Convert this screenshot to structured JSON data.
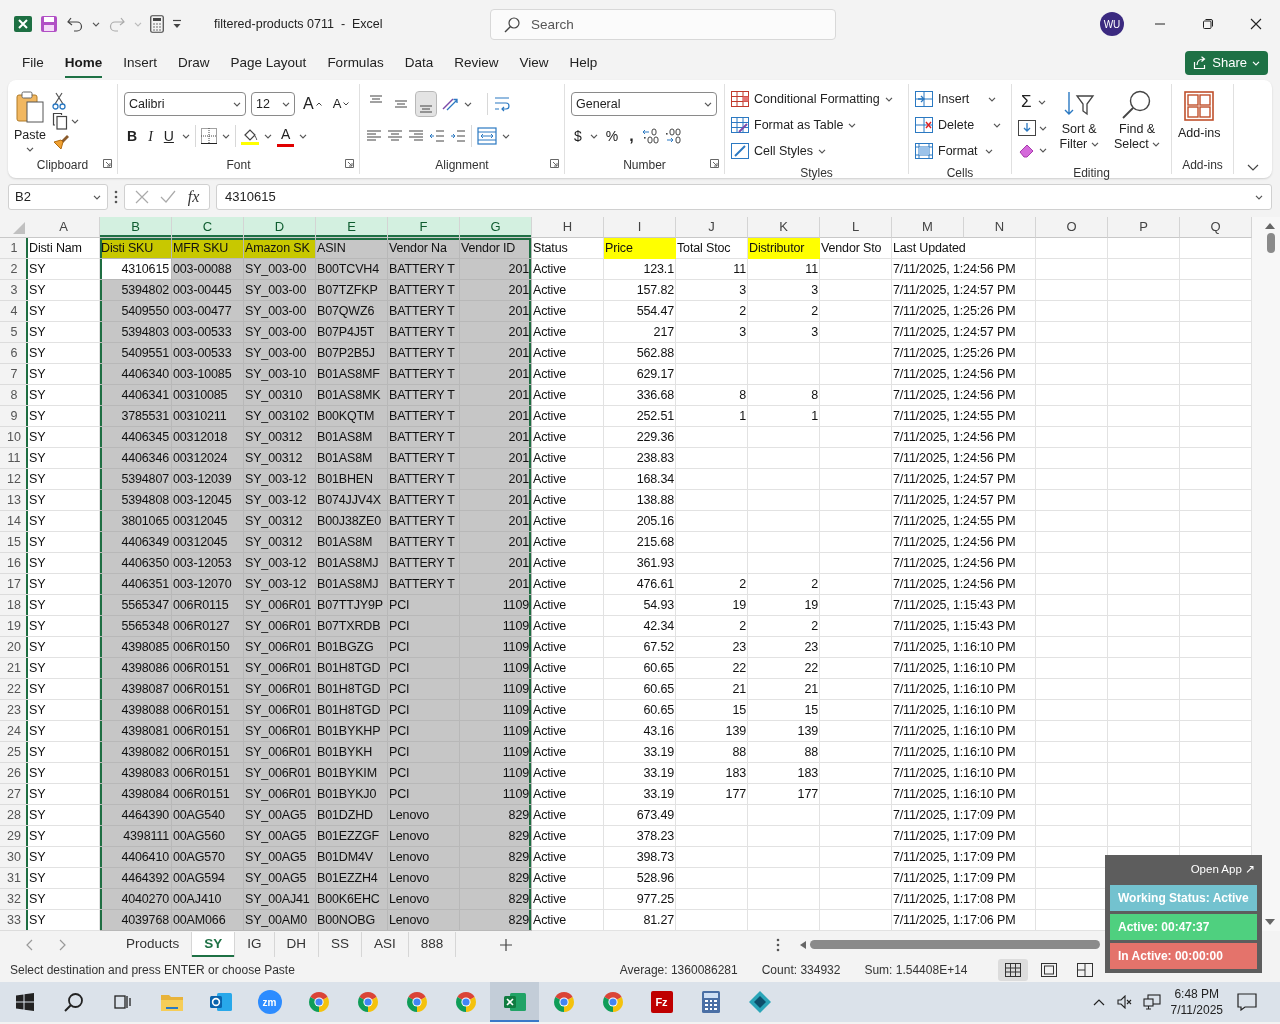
{
  "title_bar": {
    "title": "filtered-products 0711  -  Excel",
    "search_placeholder": "Search",
    "avatar": "WU"
  },
  "menu_tabs": [
    {
      "label": "File",
      "selected": false
    },
    {
      "label": "Home",
      "selected": true
    },
    {
      "label": "Insert",
      "selected": false
    },
    {
      "label": "Draw",
      "selected": false
    },
    {
      "label": "Page Layout",
      "selected": false
    },
    {
      "label": "Formulas",
      "selected": false
    },
    {
      "label": "Data",
      "selected": false
    },
    {
      "label": "Review",
      "selected": false
    },
    {
      "label": "View",
      "selected": false
    },
    {
      "label": "Help",
      "selected": false
    }
  ],
  "share": "Share",
  "ribbon": {
    "clipboard": {
      "paste": "Paste",
      "label": "Clipboard"
    },
    "font": {
      "font": "Calibri",
      "size": "12",
      "grow": "A",
      "shrink": "A",
      "bold": "B",
      "italic": "I",
      "underline": "U",
      "font_color": "A",
      "label": "Font"
    },
    "alignment": {
      "vertical": [
        {
          "selected": false
        },
        {
          "selected": false
        },
        {
          "selected": true
        }
      ],
      "label": "Alignment"
    },
    "number": {
      "format": "General",
      "currency": "$",
      "percent": "%",
      "comma": ",",
      "label": "Number"
    },
    "styles": {
      "items": [
        "Conditional Formatting",
        "Format as Table",
        "Cell Styles"
      ],
      "label": "Styles"
    },
    "cells": {
      "items": [
        "Insert",
        "Delete",
        "Format"
      ],
      "label": "Cells"
    },
    "editing": {
      "autosum": "Σ",
      "sort": "Sort & Filter",
      "find": "Find & Select",
      "label": "Editing"
    },
    "addins": {
      "button": "Add-ins",
      "label": "Add-ins"
    }
  },
  "formula_bar": {
    "name_box": "B2",
    "function_label": "fx",
    "value": "4310615"
  },
  "sheet": {
    "columns": [
      {
        "letter": "A",
        "header": "Disti Nam",
        "kind": "text",
        "selected": false,
        "active": false
      },
      {
        "letter": "B",
        "header": "Disti SKU",
        "kind": "number",
        "selected": true,
        "active": true,
        "color": "#c8c800"
      },
      {
        "letter": "C",
        "header": "MFR SKU",
        "kind": "text",
        "selected": true,
        "active": false,
        "color": "#c8c800"
      },
      {
        "letter": "D",
        "header": "Amazon SK",
        "kind": "text",
        "selected": true,
        "active": false,
        "color": "#c8c800"
      },
      {
        "letter": "E",
        "header": "ASIN",
        "kind": "text",
        "selected": true,
        "active": false
      },
      {
        "letter": "F",
        "header": "Vendor Na",
        "kind": "text",
        "selected": true,
        "active": false
      },
      {
        "letter": "G",
        "header": "Vendor ID",
        "kind": "number",
        "selected": true,
        "active": false
      },
      {
        "letter": "H",
        "header": "Status",
        "kind": "text",
        "selected": false,
        "active": false
      },
      {
        "letter": "I",
        "header": "Price",
        "kind": "number",
        "selected": false,
        "active": false,
        "color": "#ffff00"
      },
      {
        "letter": "J",
        "header": "Total Stoc",
        "kind": "number",
        "selected": false,
        "active": false
      },
      {
        "letter": "K",
        "header": "Distributor",
        "kind": "number",
        "selected": false,
        "active": false,
        "color": "#ffff00"
      },
      {
        "letter": "L",
        "header": "Vendor Sto",
        "kind": "text",
        "selected": false,
        "active": false
      },
      {
        "letter": "M",
        "header": "Last Updated",
        "kind": "text",
        "selected": false,
        "active": false
      },
      {
        "letter": "N",
        "selected": false,
        "active": false
      },
      {
        "letter": "O",
        "selected": false,
        "active": false
      },
      {
        "letter": "P",
        "selected": false,
        "active": false
      },
      {
        "letter": "Q",
        "selected": false,
        "active": false
      }
    ],
    "header_row": "1",
    "rows": [
      {
        "number": "2",
        "active": true,
        "cells": [
          "SY",
          "4310615",
          "003-00088",
          "SY_003-00",
          "B00TCVH4",
          "BATTERY T",
          "201",
          "Active",
          "123.1",
          "11",
          "11",
          "",
          "7/11/2025, 1:24:56 PM"
        ]
      },
      {
        "number": "3",
        "active": false,
        "cells": [
          "SY",
          "5394802",
          "003-00445",
          "SY_003-00",
          "B07TZFKP",
          "BATTERY T",
          "201",
          "Active",
          "157.82",
          "3",
          "3",
          "",
          "7/11/2025, 1:24:57 PM"
        ]
      },
      {
        "number": "4",
        "active": false,
        "cells": [
          "SY",
          "5409550",
          "003-00477",
          "SY_003-00",
          "B07QWZ6",
          "BATTERY T",
          "201",
          "Active",
          "554.47",
          "2",
          "2",
          "",
          "7/11/2025, 1:25:26 PM"
        ]
      },
      {
        "number": "5",
        "active": false,
        "cells": [
          "SY",
          "5394803",
          "003-00533",
          "SY_003-00",
          "B07P4J5T",
          "BATTERY T",
          "201",
          "Active",
          "217",
          "3",
          "3",
          "",
          "7/11/2025, 1:24:57 PM"
        ]
      },
      {
        "number": "6",
        "active": false,
        "cells": [
          "SY",
          "5409551",
          "003-00533",
          "SY_003-00",
          "B07P2B5J",
          "BATTERY T",
          "201",
          "Active",
          "562.88",
          "",
          "",
          "",
          "7/11/2025, 1:25:26 PM"
        ]
      },
      {
        "number": "7",
        "active": false,
        "cells": [
          "SY",
          "4406340",
          "003-10085",
          "SY_003-10",
          "B01AS8MF",
          "BATTERY T",
          "201",
          "Active",
          "629.17",
          "",
          "",
          "",
          "7/11/2025, 1:24:56 PM"
        ]
      },
      {
        "number": "8",
        "active": false,
        "cells": [
          "SY",
          "4406341",
          "00310085",
          "SY_00310",
          "B01AS8MK",
          "BATTERY T",
          "201",
          "Active",
          "336.68",
          "8",
          "8",
          "",
          "7/11/2025, 1:24:56 PM"
        ]
      },
      {
        "number": "9",
        "active": false,
        "cells": [
          "SY",
          "3785531",
          "00310211",
          "SY_003102",
          "B00KQTM",
          "BATTERY T",
          "201",
          "Active",
          "252.51",
          "1",
          "1",
          "",
          "7/11/2025, 1:24:55 PM"
        ]
      },
      {
        "number": "10",
        "active": false,
        "cells": [
          "SY",
          "4406345",
          "00312018",
          "SY_00312",
          "B01AS8M",
          "BATTERY T",
          "201",
          "Active",
          "229.36",
          "",
          "",
          "",
          "7/11/2025, 1:24:56 PM"
        ]
      },
      {
        "number": "11",
        "active": false,
        "cells": [
          "SY",
          "4406346",
          "00312024",
          "SY_00312",
          "B01AS8M",
          "BATTERY T",
          "201",
          "Active",
          "238.83",
          "",
          "",
          "",
          "7/11/2025, 1:24:56 PM"
        ]
      },
      {
        "number": "12",
        "active": false,
        "cells": [
          "SY",
          "5394807",
          "003-12039",
          "SY_003-12",
          "B01BHEN",
          "BATTERY T",
          "201",
          "Active",
          "168.34",
          "",
          "",
          "",
          "7/11/2025, 1:24:57 PM"
        ]
      },
      {
        "number": "13",
        "active": false,
        "cells": [
          "SY",
          "5394808",
          "003-12045",
          "SY_003-12",
          "B074JJV4X",
          "BATTERY T",
          "201",
          "Active",
          "138.88",
          "",
          "",
          "",
          "7/11/2025, 1:24:57 PM"
        ]
      },
      {
        "number": "14",
        "active": false,
        "cells": [
          "SY",
          "3801065",
          "00312045",
          "SY_00312",
          "B00J38ZE0",
          "BATTERY T",
          "201",
          "Active",
          "205.16",
          "",
          "",
          "",
          "7/11/2025, 1:24:55 PM"
        ]
      },
      {
        "number": "15",
        "active": false,
        "cells": [
          "SY",
          "4406349",
          "00312045",
          "SY_00312",
          "B01AS8M",
          "BATTERY T",
          "201",
          "Active",
          "215.68",
          "",
          "",
          "",
          "7/11/2025, 1:24:56 PM"
        ]
      },
      {
        "number": "16",
        "active": false,
        "cells": [
          "SY",
          "4406350",
          "003-12053",
          "SY_003-12",
          "B01AS8MJ",
          "BATTERY T",
          "201",
          "Active",
          "361.93",
          "",
          "",
          "",
          "7/11/2025, 1:24:56 PM"
        ]
      },
      {
        "number": "17",
        "active": false,
        "cells": [
          "SY",
          "4406351",
          "003-12070",
          "SY_003-12",
          "B01AS8MJ",
          "BATTERY T",
          "201",
          "Active",
          "476.61",
          "2",
          "2",
          "",
          "7/11/2025, 1:24:56 PM"
        ]
      },
      {
        "number": "18",
        "active": false,
        "cells": [
          "SY",
          "5565347",
          "006R0115",
          "SY_006R01",
          "B07TTJY9P",
          "PCI",
          "1109",
          "Active",
          "54.93",
          "19",
          "19",
          "",
          "7/11/2025, 1:15:43 PM"
        ]
      },
      {
        "number": "19",
        "active": false,
        "cells": [
          "SY",
          "5565348",
          "006R0127",
          "SY_006R01",
          "B07TXRDB",
          "PCI",
          "1109",
          "Active",
          "42.34",
          "2",
          "2",
          "",
          "7/11/2025, 1:15:43 PM"
        ]
      },
      {
        "number": "20",
        "active": false,
        "cells": [
          "SY",
          "4398085",
          "006R0150",
          "SY_006R01",
          "B01BGZG",
          "PCI",
          "1109",
          "Active",
          "67.52",
          "23",
          "23",
          "",
          "7/11/2025, 1:16:10 PM"
        ]
      },
      {
        "number": "21",
        "active": false,
        "cells": [
          "SY",
          "4398086",
          "006R0151",
          "SY_006R01",
          "B01H8TGD",
          "PCI",
          "1109",
          "Active",
          "60.65",
          "22",
          "22",
          "",
          "7/11/2025, 1:16:10 PM"
        ]
      },
      {
        "number": "22",
        "active": false,
        "cells": [
          "SY",
          "4398087",
          "006R0151",
          "SY_006R01",
          "B01H8TGD",
          "PCI",
          "1109",
          "Active",
          "60.65",
          "21",
          "21",
          "",
          "7/11/2025, 1:16:10 PM"
        ]
      },
      {
        "number": "23",
        "active": false,
        "cells": [
          "SY",
          "4398088",
          "006R0151",
          "SY_006R01",
          "B01H8TGD",
          "PCI",
          "1109",
          "Active",
          "60.65",
          "15",
          "15",
          "",
          "7/11/2025, 1:16:10 PM"
        ]
      },
      {
        "number": "24",
        "active": false,
        "cells": [
          "SY",
          "4398081",
          "006R0151",
          "SY_006R01",
          "B01BYKHP",
          "PCI",
          "1109",
          "Active",
          "43.16",
          "139",
          "139",
          "",
          "7/11/2025, 1:16:10 PM"
        ]
      },
      {
        "number": "25",
        "active": false,
        "cells": [
          "SY",
          "4398082",
          "006R0151",
          "SY_006R01",
          "B01BYKH",
          "PCI",
          "1109",
          "Active",
          "33.19",
          "88",
          "88",
          "",
          "7/11/2025, 1:16:10 PM"
        ]
      },
      {
        "number": "26",
        "active": false,
        "cells": [
          "SY",
          "4398083",
          "006R0151",
          "SY_006R01",
          "B01BYKIM",
          "PCI",
          "1109",
          "Active",
          "33.19",
          "183",
          "183",
          "",
          "7/11/2025, 1:16:10 PM"
        ]
      },
      {
        "number": "27",
        "active": false,
        "cells": [
          "SY",
          "4398084",
          "006R0151",
          "SY_006R01",
          "B01BYKJ0",
          "PCI",
          "1109",
          "Active",
          "33.19",
          "177",
          "177",
          "",
          "7/11/2025, 1:16:10 PM"
        ]
      },
      {
        "number": "28",
        "active": false,
        "cells": [
          "SY",
          "4464390",
          "00AG540",
          "SY_00AG5",
          "B01DZHD",
          "Lenovo",
          "829",
          "Active",
          "673.49",
          "",
          "",
          "",
          "7/11/2025, 1:17:09 PM"
        ]
      },
      {
        "number": "29",
        "active": false,
        "cells": [
          "SY",
          "4398111",
          "00AG560",
          "SY_00AG5",
          "B01EZZGF",
          "Lenovo",
          "829",
          "Active",
          "378.23",
          "",
          "",
          "",
          "7/11/2025, 1:17:09 PM"
        ]
      },
      {
        "number": "30",
        "active": false,
        "cells": [
          "SY",
          "4406410",
          "00AG570",
          "SY_00AG5",
          "B01DM4V",
          "Lenovo",
          "829",
          "Active",
          "398.73",
          "",
          "",
          "",
          "7/11/2025, 1:17:09 PM"
        ]
      },
      {
        "number": "31",
        "active": false,
        "cells": [
          "SY",
          "4464392",
          "00AG594",
          "SY_00AG5",
          "B01EZZH4",
          "Lenovo",
          "829",
          "Active",
          "528.96",
          "",
          "",
          "",
          "7/11/2025, 1:17:09 PM"
        ]
      },
      {
        "number": "32",
        "active": false,
        "cells": [
          "SY",
          "4040270",
          "00AJ410",
          "SY_00AJ41",
          "B00K6EHC",
          "Lenovo",
          "829",
          "Active",
          "977.25",
          "",
          "",
          "",
          "7/11/2025, 1:17:08 PM"
        ]
      },
      {
        "number": "33",
        "active": false,
        "cells": [
          "SY",
          "4039768",
          "00AM066",
          "SY_00AM0",
          "B00NOBG",
          "Lenovo",
          "829",
          "Active",
          "81.27",
          "",
          "",
          "",
          "7/11/2025, 1:17:06 PM"
        ]
      }
    ]
  },
  "sheet_tabs": [
    {
      "label": "Products",
      "selected": false
    },
    {
      "label": "SY",
      "selected": true
    },
    {
      "label": "IG",
      "selected": false
    },
    {
      "label": "DH",
      "selected": false
    },
    {
      "label": "SS",
      "selected": false
    },
    {
      "label": "ASI",
      "selected": false
    },
    {
      "label": "888",
      "selected": false
    }
  ],
  "status_bar": {
    "message": "Select destination and press ENTER or choose Paste",
    "average": "Average: 1360086281",
    "count": "Count: 334932",
    "sum": "Sum: 1.54408E+14",
    "views": [
      {
        "kind": "normal",
        "selected": true
      },
      {
        "kind": "page-layout",
        "selected": false
      },
      {
        "kind": "page-break",
        "selected": false
      }
    ]
  },
  "taskbar": {
    "apps": [
      {
        "kind": "start",
        "selected": false
      },
      {
        "kind": "search",
        "selected": false
      },
      {
        "kind": "task-view",
        "selected": false
      },
      {
        "kind": "folder",
        "selected": false
      },
      {
        "kind": "mail",
        "selected": false
      },
      {
        "kind": "video",
        "label": "zm",
        "selected": false
      },
      {
        "kind": "browser",
        "selected": false
      },
      {
        "kind": "browser",
        "selected": false
      },
      {
        "kind": "browser",
        "selected": false
      },
      {
        "kind": "browser",
        "selected": false
      },
      {
        "kind": "spreadsheet",
        "selected": true
      },
      {
        "kind": "browser",
        "selected": false
      },
      {
        "kind": "browser",
        "selected": false
      },
      {
        "kind": "ftp",
        "label": "Fz",
        "selected": false
      },
      {
        "kind": "calculator",
        "selected": false
      },
      {
        "kind": "diamond",
        "selected": false
      }
    ],
    "time": "6:48 PM",
    "date": "7/11/2025"
  },
  "tracker": {
    "open": "Open App ↗",
    "lines": [
      {
        "text": "Working Status: Active",
        "color": "#73c2cf"
      },
      {
        "text": "Active: 00:47:37",
        "color": "#4fd07f"
      },
      {
        "text": "In Active: 00:00:00",
        "color": "#e4736b"
      }
    ]
  }
}
